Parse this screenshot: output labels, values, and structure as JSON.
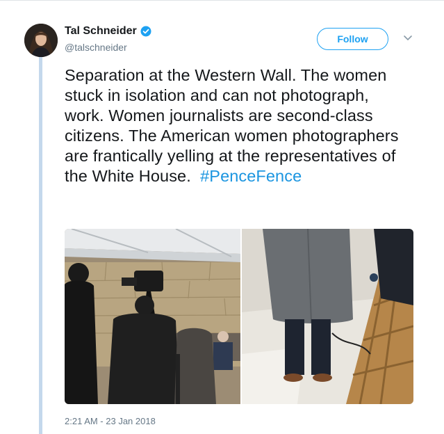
{
  "tweet": {
    "author_name": "Tal Schneider",
    "author_handle": "@talschneider",
    "follow_label": "Follow",
    "text_before_hashtag": "Separation at the Western Wall. The women stuck in isolation and can not photograph, work. Women journalists are second-class citizens. The American women photographers are frantically yelling at the representatives of the White House.",
    "hashtag": "#PenceFence",
    "timestamp": "2:21 AM - 23 Jan 2018"
  },
  "icons": {
    "verified": "verified-badge-icon",
    "more": "chevron-down-icon"
  },
  "colors": {
    "accent": "#1da1f2",
    "hashtag": "#1b95e0",
    "muted": "#657786",
    "thread_line": "#c4d8ec"
  }
}
